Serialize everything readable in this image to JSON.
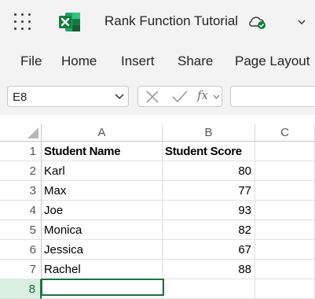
{
  "titlebar": {
    "document_title": "Rank Function Tutorial",
    "app_icon": "excel-logo",
    "colors": {
      "excel_green": "#1e7145",
      "accent_green": "#21a366"
    }
  },
  "ribbon": {
    "tabs": [
      "File",
      "Home",
      "Insert",
      "Share",
      "Page Layout"
    ]
  },
  "formula_bar": {
    "name_box": "E8",
    "fx_label": "fx",
    "formula": ""
  },
  "sheet": {
    "columns": [
      "A",
      "B",
      "C"
    ],
    "rows": [
      {
        "num": "1",
        "a": "Student Name",
        "b": "Student Score"
      },
      {
        "num": "2",
        "a": "Karl",
        "b": "80"
      },
      {
        "num": "3",
        "a": "Max",
        "b": "77"
      },
      {
        "num": "4",
        "a": "Joe",
        "b": "93"
      },
      {
        "num": "5",
        "a": "Monica",
        "b": "82"
      },
      {
        "num": "6",
        "a": "Jessica",
        "b": "67"
      },
      {
        "num": "7",
        "a": "Rachel",
        "b": "88"
      },
      {
        "num": "8",
        "a": "",
        "b": ""
      }
    ]
  }
}
